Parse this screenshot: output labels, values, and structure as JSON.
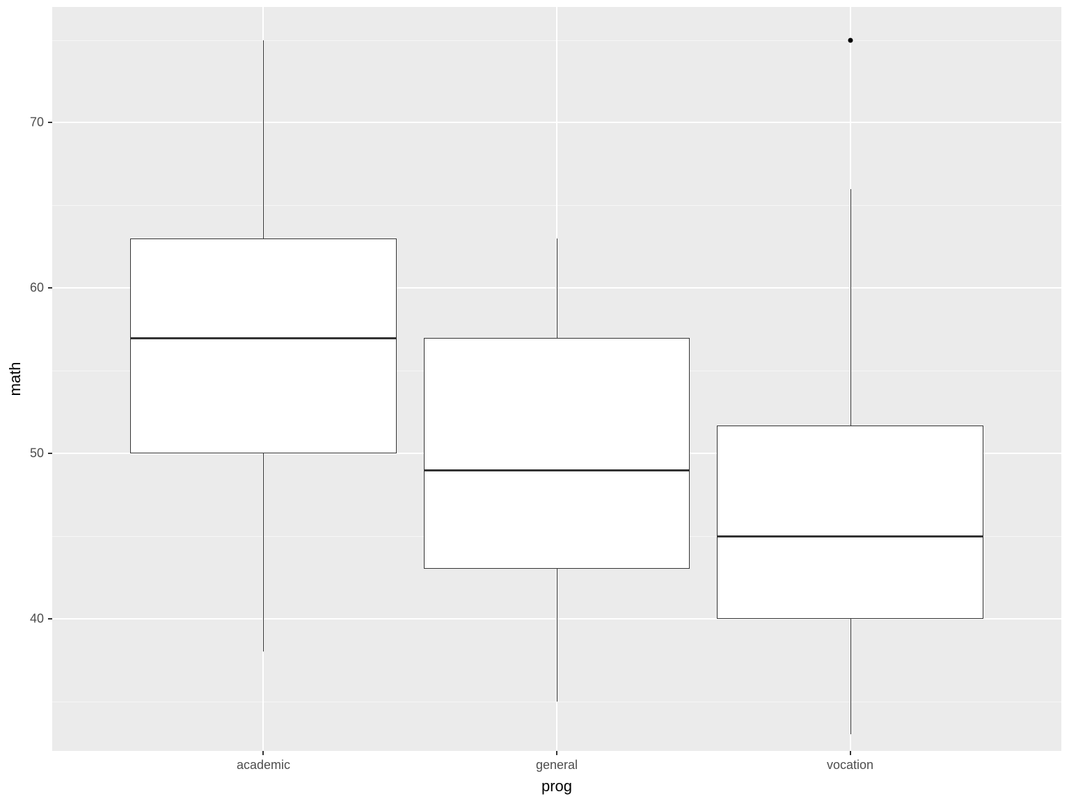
{
  "chart_data": {
    "type": "box",
    "xlabel": "prog",
    "ylabel": "math",
    "categories": [
      "academic",
      "general",
      "vocation"
    ],
    "y_ticks": [
      40,
      50,
      60,
      70
    ],
    "y_minor_ticks": [
      35,
      45,
      55,
      65,
      75
    ],
    "ylim": [
      32,
      77
    ],
    "series": [
      {
        "name": "academic",
        "min": 38,
        "q1": 50,
        "median": 57,
        "q3": 63,
        "max": 75,
        "outliers": []
      },
      {
        "name": "general",
        "min": 35,
        "q1": 43,
        "median": 49,
        "q3": 57,
        "max": 63,
        "outliers": []
      },
      {
        "name": "vocation",
        "min": 33,
        "q1": 40,
        "median": 45,
        "q3": 51.7,
        "max": 66,
        "outliers": [
          75
        ]
      }
    ],
    "panel_bg": "#EBEBEB",
    "box_fill": "#ffffff",
    "box_stroke": "#333333"
  }
}
